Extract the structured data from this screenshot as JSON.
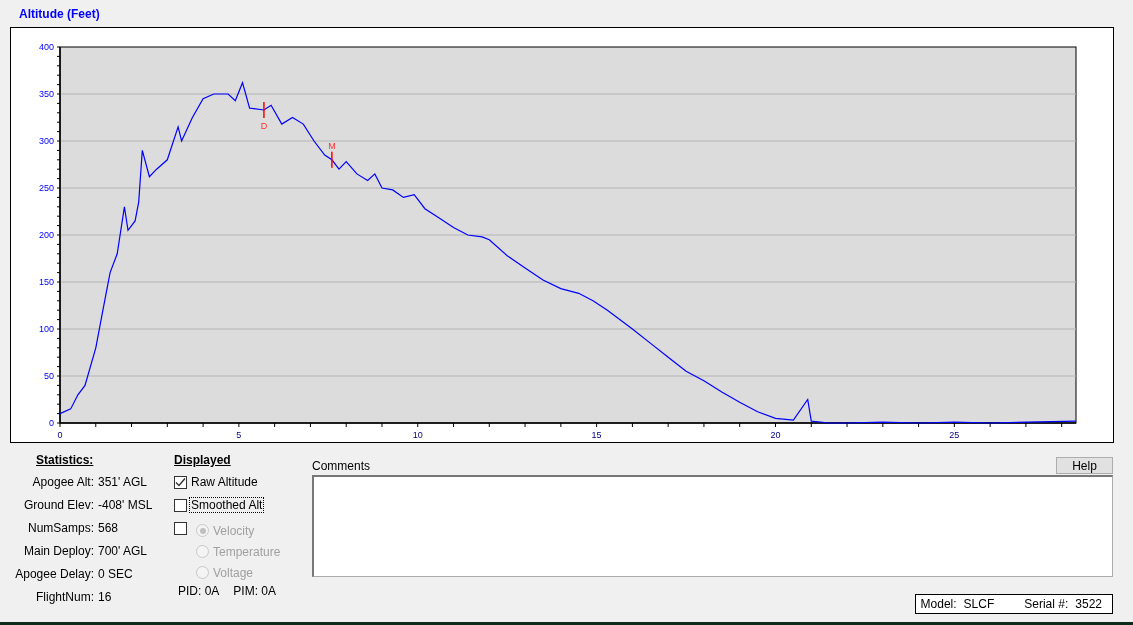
{
  "chart_title": "Altitude (Feet)",
  "chart": {
    "chart_data": {
      "type": "line",
      "grid": true,
      "xlim": [
        0,
        28.4
      ],
      "ylim": [
        0,
        400
      ],
      "xticks": [
        0,
        5,
        10,
        15,
        20,
        25
      ],
      "yticks": [
        0,
        50,
        100,
        150,
        200,
        250,
        300,
        350,
        400
      ],
      "x": [
        0,
        0.3,
        0.5,
        0.7,
        1.0,
        1.2,
        1.4,
        1.6,
        1.8,
        1.9,
        2.1,
        2.2,
        2.3,
        2.5,
        2.7,
        3.0,
        3.3,
        3.4,
        3.7,
        4.0,
        4.3,
        4.7,
        4.9,
        5.1,
        5.3,
        5.7,
        5.9,
        6.2,
        6.5,
        6.8,
        7.1,
        7.4,
        7.6,
        7.8,
        8.0,
        8.3,
        8.6,
        8.8,
        9.0,
        9.3,
        9.6,
        9.9,
        10.2,
        10.6,
        11.0,
        11.4,
        11.8,
        12.0,
        12.5,
        13.0,
        13.5,
        14.0,
        14.5,
        14.9,
        15.3,
        16.0,
        16.5,
        17.0,
        17.5,
        18.0,
        18.5,
        19.0,
        19.5,
        20.0,
        20.5,
        20.9,
        21.0,
        21.5,
        22.0,
        23.0,
        24.0,
        25.0,
        26.0,
        27.0,
        28.4
      ],
      "series": [
        {
          "color": "#0000ff",
          "values": [
            10,
            15,
            30,
            40,
            80,
            120,
            160,
            180,
            230,
            205,
            215,
            235,
            290,
            262,
            270,
            280,
            315,
            300,
            325,
            345,
            350,
            350,
            343,
            362,
            335,
            333,
            338,
            318,
            325,
            318,
            300,
            285,
            280,
            270,
            278,
            265,
            258,
            265,
            250,
            248,
            240,
            243,
            228,
            218,
            208,
            200,
            198,
            195,
            178,
            165,
            152,
            143,
            138,
            130,
            120,
            100,
            85,
            70,
            55,
            45,
            33,
            22,
            12,
            5,
            3,
            25,
            2,
            0,
            0,
            1,
            0,
            1,
            0,
            1,
            2
          ]
        }
      ],
      "annotations": [
        {
          "x": 5.7,
          "y": 333,
          "text": "D"
        },
        {
          "x": 7.6,
          "y": 280,
          "text": "M"
        }
      ]
    }
  },
  "statistics": {
    "heading": "Statistics:",
    "rows": [
      {
        "label": "Apogee Alt:",
        "value": "351' AGL"
      },
      {
        "label": "Ground Elev:",
        "value": "-408' MSL"
      },
      {
        "label": "NumSamps:",
        "value": "568"
      },
      {
        "label": "Main Deploy:",
        "value": "700' AGL"
      },
      {
        "label": "Apogee Delay:",
        "value": "0 SEC"
      },
      {
        "label": "FlightNum:",
        "value": "16"
      }
    ]
  },
  "displayed": {
    "heading": "Displayed",
    "checkboxes": [
      {
        "label": "Raw Altitude",
        "checked": true,
        "focused": false
      },
      {
        "label": "Smoothed Alt",
        "checked": false,
        "focused": true
      },
      {
        "checked": false
      }
    ],
    "radios": [
      {
        "label": "Velocity",
        "selected": true,
        "disabled": true
      },
      {
        "label": "Temperature",
        "selected": false,
        "disabled": true
      },
      {
        "label": "Voltage",
        "selected": false,
        "disabled": true
      }
    ],
    "pid": "PID: 0A",
    "pim": "PIM: 0A"
  },
  "comments": {
    "label": "Comments"
  },
  "help_button": "Help",
  "device": {
    "model_label": "Model:",
    "model": "SLCF",
    "serial_label": "Serial #:",
    "serial": "3522"
  }
}
